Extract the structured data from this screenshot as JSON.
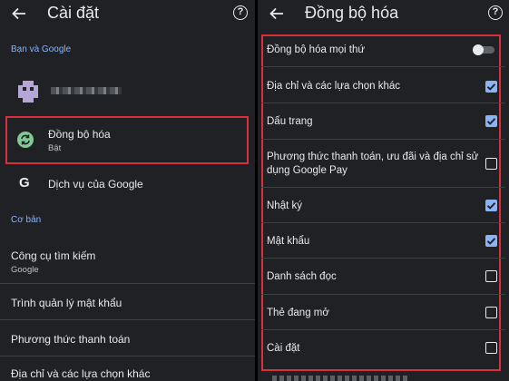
{
  "left": {
    "title": "Cài đặt",
    "section_account": "Bạn và Google",
    "sync": {
      "label": "Đồng bộ hóa",
      "status": "Bật"
    },
    "google_services": "Dịch vụ của Google",
    "section_basic": "Cơ bản",
    "search_engine": {
      "label": "Công cụ tìm kiếm",
      "value": "Google"
    },
    "password_manager": "Trình quản lý mật khẩu",
    "payment_methods": "Phương thức thanh toán",
    "addresses": "Địa chỉ và các lựa chọn khác"
  },
  "right": {
    "title": "Đồng bộ hóa",
    "sync_everything": {
      "label": "Đồng bộ hóa mọi thứ",
      "enabled": false
    },
    "options": [
      {
        "label": "Địa chỉ và các lựa chọn khác",
        "checked": true
      },
      {
        "label": "Dấu trang",
        "checked": true
      },
      {
        "label": "Phương thức thanh toán, ưu đãi và địa chỉ sử dụng Google Pay",
        "checked": false
      },
      {
        "label": "Nhật ký",
        "checked": true
      },
      {
        "label": "Mật khẩu",
        "checked": true
      },
      {
        "label": "Danh sách đọc",
        "checked": false
      },
      {
        "label": "Thẻ đang mở",
        "checked": false
      },
      {
        "label": "Cài đặt",
        "checked": false
      }
    ]
  },
  "colors": {
    "background": "#202124",
    "accent": "#8ab4f8",
    "highlight": "#d92f3a",
    "sync_icon": "#81c995"
  },
  "icons": {
    "back": "arrow-left-icon",
    "help": "help-circle-icon",
    "sync": "sync-icon",
    "google": "google-g-icon"
  }
}
